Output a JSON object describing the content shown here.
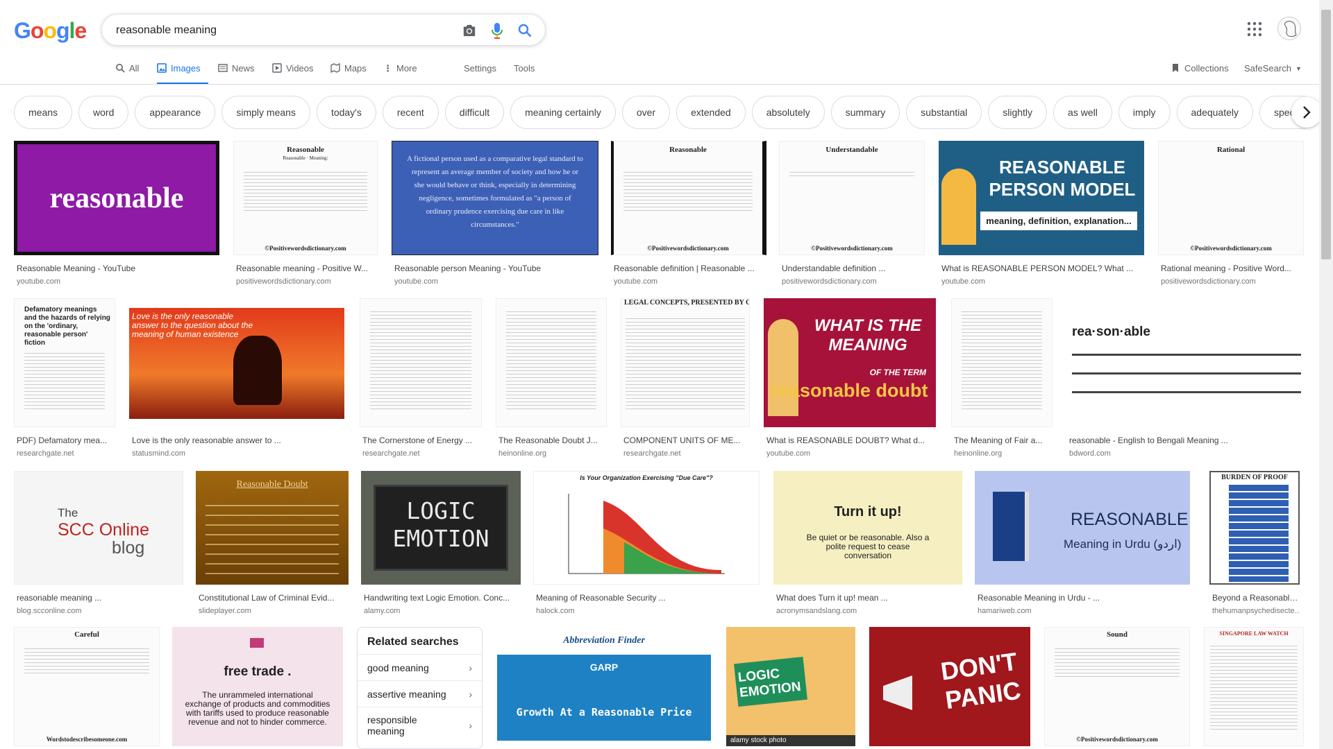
{
  "logo": {
    "letters": [
      "G",
      "o",
      "o",
      "g",
      "l",
      "e"
    ],
    "colors": [
      "#4285F4",
      "#EA4335",
      "#FBBC05",
      "#4285F4",
      "#34A853",
      "#EA4335"
    ]
  },
  "search": {
    "value": "reasonable meaning"
  },
  "tabs": [
    {
      "label": "All"
    },
    {
      "label": "Images"
    },
    {
      "label": "News"
    },
    {
      "label": "Videos"
    },
    {
      "label": "Maps"
    },
    {
      "label": "More"
    },
    {
      "label": "Settings"
    },
    {
      "label": "Tools"
    }
  ],
  "header_right": {
    "collections": "Collections",
    "safesearch": "SafeSearch"
  },
  "chips": [
    "means",
    "word",
    "appearance",
    "simply means",
    "today's",
    "recent",
    "difficult",
    "meaning certainly",
    "over",
    "extended",
    "absolutely",
    "summary",
    "substantial",
    "slightly",
    "as well",
    "imply",
    "adequately",
    "special"
  ],
  "results": [
    {
      "caption": "Reasonable Meaning - YouTube",
      "source": "youtube.com",
      "text": "reasonable"
    },
    {
      "caption": "Reasonable meaning - Positive W...",
      "source": "positivewordsdictionary.com",
      "text": "Reasonable",
      "sub": "Reasonable · Meaning:",
      "foot": "©Positivewordsdictionary.com"
    },
    {
      "caption": "Reasonable person Meaning - YouTube",
      "source": "youtube.com",
      "text": "A fictional person used as a comparative legal standard to represent an average member of society and how he or she would behave or think, especially in determining negligence, sometimes formulated as \"a person of ordinary prudence exercising due care in like circumstances.\""
    },
    {
      "caption": "Reasonable definition | Reasonable ...",
      "source": "youtube.com",
      "text": "Reasonable",
      "foot": "©Positivewordsdictionary.com"
    },
    {
      "caption": "Understandable definition ...",
      "source": "positivewordsdictionary.com",
      "text": "Understandable",
      "foot": "©Positivewordsdictionary.com"
    },
    {
      "caption": "What is REASONABLE PERSON MODEL? What ...",
      "source": "youtube.com",
      "text": "REASONABLE PERSON MODEL",
      "sub": "meaning, definition, explanation..."
    },
    {
      "caption": "Rational meaning - Positive Word...",
      "source": "positivewordsdictionary.com",
      "text": "Rational",
      "foot": "©Positivewordsdictionary.com"
    },
    {
      "caption": "PDF) Defamatory mea...",
      "source": "researchgate.net",
      "text": "Defamatory meanings and the hazards of relying on the 'ordinary, reasonable person' fiction"
    },
    {
      "caption": "Love is the only reasonable answer to ...",
      "source": "statusmind.com",
      "text": "Love is the only reasonable answer to the question about the meaning of human existence"
    },
    {
      "caption": "The Cornerstone of Energy ...",
      "source": "researchgate.net"
    },
    {
      "caption": "The Reasonable Doubt J...",
      "source": "heinonline.org"
    },
    {
      "caption": "COMPONENT UNITS OF ME...",
      "source": "researchgate.net",
      "text": "LEGAL CONCEPTS, PRESENTED BY CONC"
    },
    {
      "caption": "What is REASONABLE DOUBT? What d...",
      "source": "youtube.com",
      "text": "WHAT IS THE MEANING",
      "sub": "OF THE TERM",
      "sub2": "reasonable doubt"
    },
    {
      "caption": "The Meaning of Fair a...",
      "source": "heinonline.org"
    },
    {
      "caption": "reasonable - English to Bengali Meaning ...",
      "source": "bdword.com",
      "text": "rea·son·able"
    },
    {
      "caption": "reasonable meaning ...",
      "source": "blog.scconline.com",
      "text": "The",
      "sub": "SCC Online",
      "sub2": "blog"
    },
    {
      "caption": "Constitutional Law of Criminal Evid...",
      "source": "slideplayer.com",
      "text": "Reasonable Doubt"
    },
    {
      "caption": "Handwriting text Logic Emotion. Conc...",
      "source": "alamy.com",
      "text": "LOGIC EMOTION"
    },
    {
      "caption": "Meaning of Reasonable Security ...",
      "source": "halock.com",
      "text": "Is Your Organization Exercising \"Due Care\"?"
    },
    {
      "caption": "What does Turn it up! mean ...",
      "source": "acronymsandslang.com",
      "text": "Turn it up!",
      "sub": "Be quiet or be reasonable. Also a polite request to cease conversation"
    },
    {
      "caption": "Reasonable Meaning in Urdu - ...",
      "source": "hamariweb.com",
      "text": "REASONABLE",
      "sub": "Meaning in Urdu (اردو)"
    },
    {
      "caption": "Beyond a Reasonable...",
      "source": "thehumanpsychedisecte...",
      "text": "BURDEN OF PROOF"
    },
    {
      "text": "Careful",
      "foot": "Wordstodescribesomeone.com"
    },
    {
      "text": "free trade .",
      "sub": "The unrammeled international exchange of products and commodities with tariffs used to produce reasonable revenue and not to hinder commerce."
    },
    {
      "text": "Abbreviation Finder",
      "sub": "GARP",
      "sub2": "Growth At a Reasonable Price"
    },
    {
      "text": "LOGIC EMOTION",
      "sub": "alamy stock photo"
    },
    {
      "text": "DON'T PANIC"
    },
    {
      "text": "Sound",
      "foot": "©Positivewordsdictionary.com"
    },
    {
      "text": "SINGAPORE LAW WATCH"
    }
  ],
  "related": {
    "title": "Related searches",
    "items": [
      "good meaning",
      "assertive meaning",
      "responsible meaning"
    ]
  }
}
